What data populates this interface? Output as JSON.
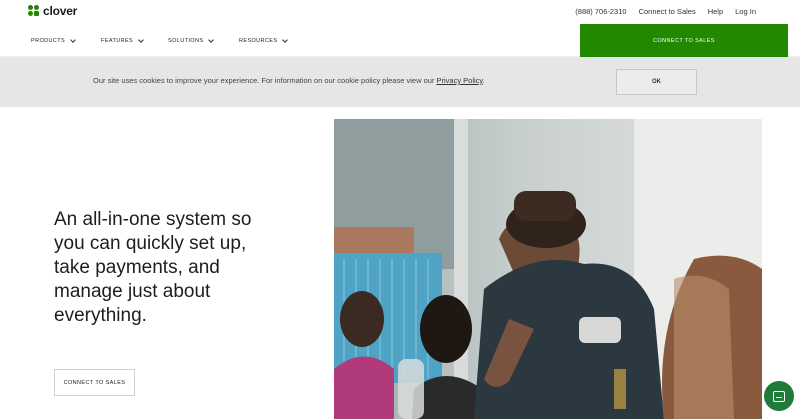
{
  "brand": {
    "name": "clover",
    "color": "#228800"
  },
  "utility_nav": {
    "phone": "(888) 706-2310",
    "connect": "Connect to Sales",
    "help": "Help",
    "login": "Log In"
  },
  "main_nav": {
    "items": [
      {
        "label": "PRODUCTS"
      },
      {
        "label": "FEATURES"
      },
      {
        "label": "SOLUTIONS"
      },
      {
        "label": "RESOURCES"
      }
    ],
    "cta": "CONNECT TO SALES"
  },
  "cookie_banner": {
    "text": "Our site uses cookies to improve your experience. For information on our cookie policy please view our ",
    "link": "Privacy Policy",
    "suffix": ".",
    "ok": "OK"
  },
  "hero": {
    "headline": "An all-in-one system so you can quickly set up, take payments, and manage just about everything.",
    "cta": "CONNECT TO SALES"
  },
  "icons": {
    "logo": "clover-leaf-icon",
    "chevron": "chevron-down-icon",
    "chat": "chat-icon"
  }
}
